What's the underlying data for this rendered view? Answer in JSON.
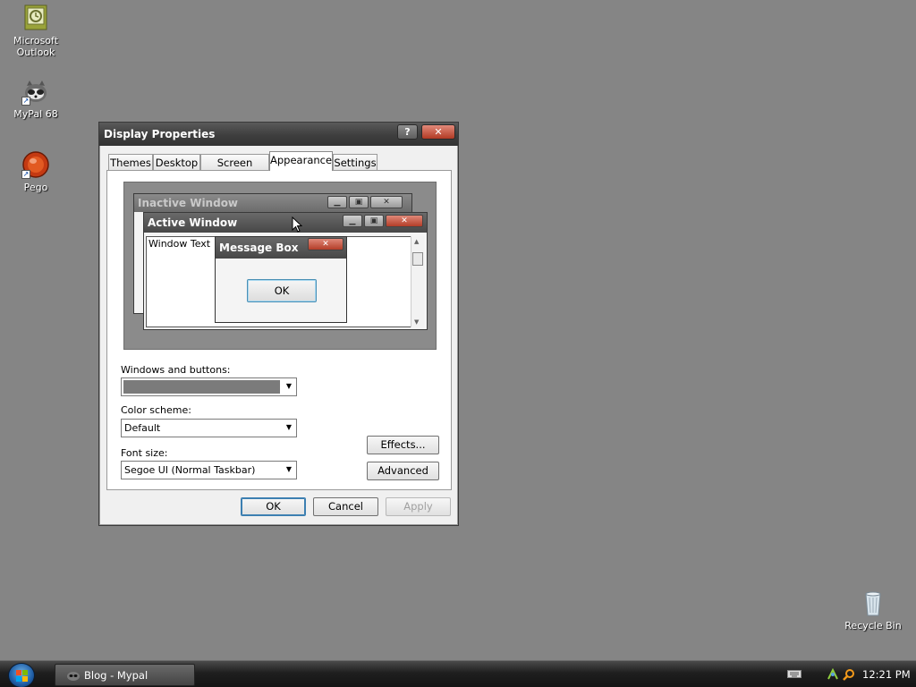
{
  "desktop": {
    "icons": [
      {
        "label_line1": "Microsoft",
        "label_line2": "Outlook",
        "icon": "outlook-icon"
      },
      {
        "label_line1": "MyPal 68",
        "label_line2": "",
        "icon": "mypal-icon"
      },
      {
        "label_line1": "Pego",
        "label_line2": "",
        "icon": "pego-icon"
      },
      {
        "label_line1": "Recycle Bin",
        "label_line2": "",
        "icon": "recycle-bin-icon"
      }
    ]
  },
  "dialog": {
    "title": "Display Properties",
    "help_label": "?",
    "close_label": "✕",
    "tabs": [
      {
        "label": "Themes"
      },
      {
        "label": "Desktop"
      },
      {
        "label": "Screen Saver"
      },
      {
        "label": "Appearance"
      },
      {
        "label": "Settings"
      }
    ],
    "active_tab": "Appearance",
    "preview": {
      "inactive_title": "Inactive Window",
      "active_title": "Active Window",
      "window_text": "Window Text",
      "message_box_title": "Message Box",
      "message_box_ok": "OK"
    },
    "windows_and_buttons_label": "Windows and buttons:",
    "windows_and_buttons_value": "",
    "color_scheme_label": "Color scheme:",
    "color_scheme_value": "Default",
    "font_size_label": "Font size:",
    "font_size_value": "Segoe UI (Normal Taskbar)",
    "effects_label": "Effects...",
    "advanced_label": "Advanced",
    "ok_label": "OK",
    "cancel_label": "Cancel",
    "apply_label": "Apply"
  },
  "taskbar": {
    "task_label": "Blog - Mypal",
    "clock": "12:21 PM"
  },
  "colors": {
    "desktop": "#858585",
    "titlebar": "#3e3e3e",
    "close_button": "#b13a24"
  }
}
